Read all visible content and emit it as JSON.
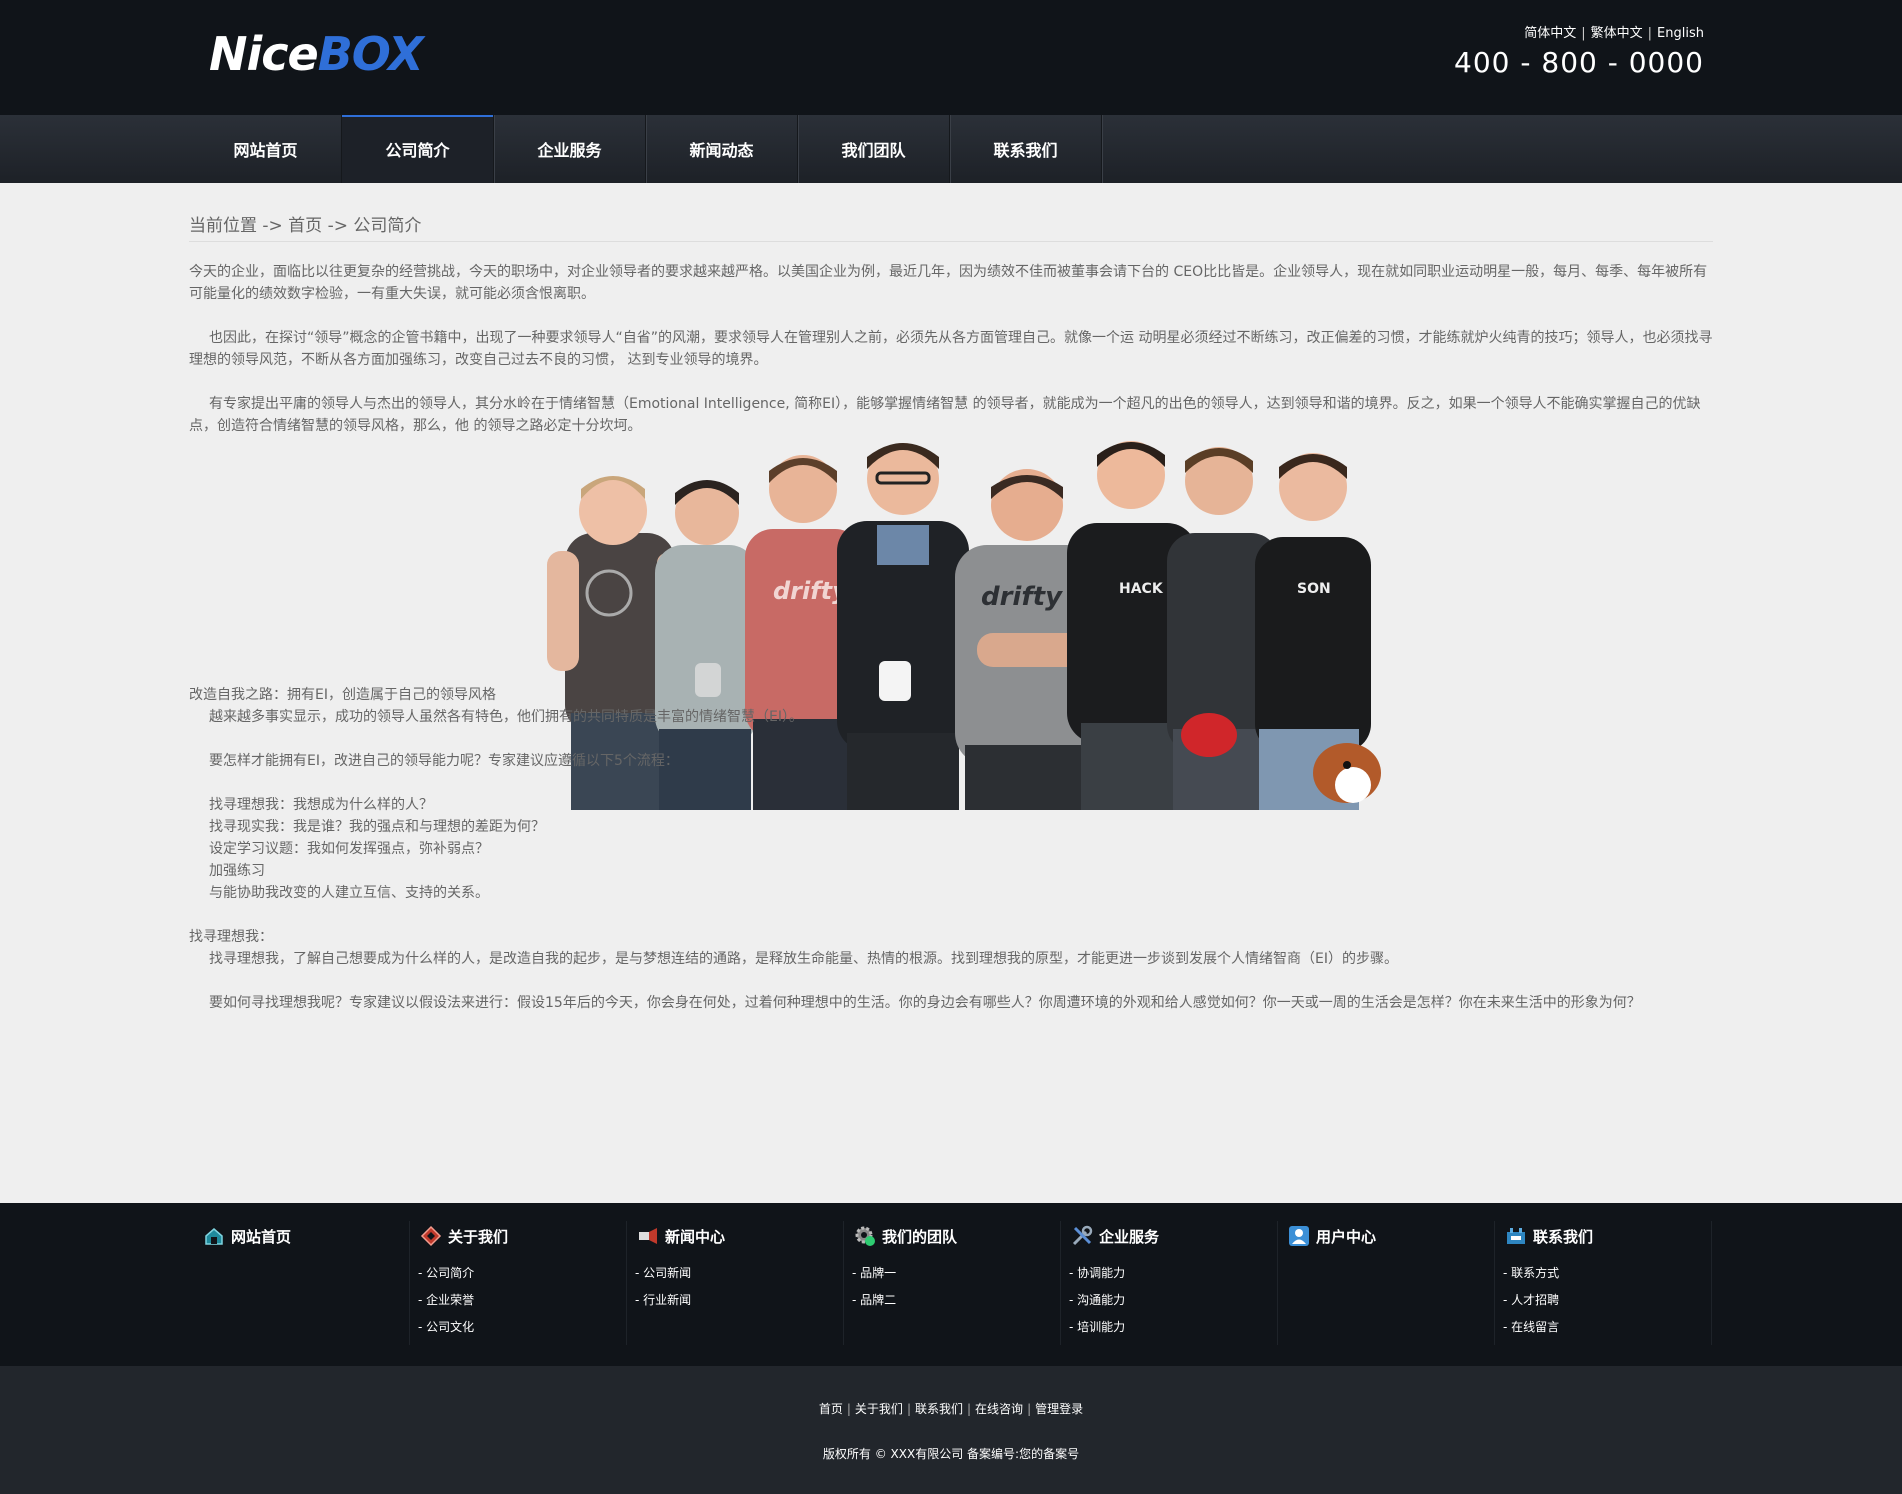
{
  "header": {
    "logo_part1": "Nice",
    "logo_part2": "BOX",
    "languages": [
      "简体中文",
      "繁体中文",
      "English"
    ],
    "phone": "400 - 800 - 0000"
  },
  "nav": {
    "items": [
      "网站首页",
      "公司简介",
      "企业服务",
      "新闻动态",
      "我们团队",
      "联系我们"
    ],
    "active_index": 1
  },
  "breadcrumb": "当前位置 -> 首页 -> 公司简介",
  "article": {
    "p1": "今天的企业，面临比以往更复杂的经营挑战，今天的职场中，对企业领导者的要求越来越严格。以美国企业为例，最近几年，因为绩效不佳而被董事会请下台的 CEO比比皆是。企业领导人，现在就如同职业运动明星一般，每月、每季、每年被所有可能量化的绩效数字检验，一有重大失误，就可能必须含恨离职。",
    "p2": "也因此，在探讨“领导”概念的企管书籍中，出现了一种要求领导人“自省”的风潮，要求领导人在管理别人之前，必须先从各方面管理自己。就像一个运 动明星必须经过不断练习，改正偏差的习惯，才能练就炉火纯青的技巧；领导人，也必须找寻理想的领导风范，不断从各方面加强练习，改变自己过去不良的习惯， 达到专业领导的境界。",
    "p3": "有专家提出平庸的领导人与杰出的领导人，其分水岭在于情绪智慧（Emotional Intelligence, 简称EI），能够掌握情绪智慧 的领导者，就能成为一个超凡的出色的领导人，达到领导和谐的境界。反之，如果一个领导人不能确实掌握自己的优缺点，创造符合情绪智慧的领导风格，那么，他 的领导之路必定十分坎坷。",
    "s1_title": "改造自我之路：拥有EI，创造属于自己的领导风格",
    "s1_line1": "越来越多事实显示，成功的领导人虽然各有特色，他们拥有的共同特质是丰富的情绪智慧（EI）。",
    "s1_line2": "要怎样才能拥有EI，改进自己的领导能力呢？专家建议应遵循以下5个流程：",
    "steps": [
      "找寻理想我：我想成为什么样的人？",
      "找寻现实我：我是谁？我的强点和与理想的差距为何？",
      "设定学习议题：我如何发挥强点，弥补弱点？",
      "加强练习",
      "与能协助我改变的人建立互信、支持的关系。"
    ],
    "s2_title": "找寻理想我：",
    "s2_line1": "找寻理想我，了解自己想要成为什么样的人，是改造自我的起步，是与梦想连结的通路，是释放生命能量、热情的根源。找到理想我的原型，才能更进一步谈到发展个人情绪智商（EI）的步骤。",
    "s2_line2": "要如何寻找理想我呢？专家建议以假设法来进行：假设15年后的今天，你会身在何处，过着何种理想中的生活。你的身边会有哪些人？你周遭环境的外观和给人感觉如何？你一天或一周的生活会是怎样？你在未来生活中的形象为何？"
  },
  "footer": {
    "columns": [
      {
        "title": "网站首页",
        "icon": "home-icon",
        "links": []
      },
      {
        "title": "关于我们",
        "icon": "diamond-icon",
        "links": [
          "- 公司简介",
          "- 企业荣誉",
          "- 公司文化"
        ]
      },
      {
        "title": "新闻中心",
        "icon": "megaphone-icon",
        "links": [
          "- 公司新闻",
          "- 行业新闻"
        ]
      },
      {
        "title": "我们的团队",
        "icon": "gear-icon",
        "links": [
          "- 品牌一",
          "- 品牌二"
        ]
      },
      {
        "title": "企业服务",
        "icon": "tools-icon",
        "links": [
          "- 协调能力",
          "- 沟通能力",
          "- 培训能力"
        ]
      },
      {
        "title": "用户中心",
        "icon": "user-icon",
        "links": []
      },
      {
        "title": "联系我们",
        "icon": "contact-icon",
        "links": [
          "- 联系方式",
          "- 人才招聘",
          "- 在线留言"
        ]
      }
    ]
  },
  "bottom": {
    "links": [
      "首页",
      "关于我们",
      "联系我们",
      "在线咨询",
      "管理登录"
    ],
    "copyright": "版权所有 © XXX有限公司  备案编号:您的备案号"
  }
}
